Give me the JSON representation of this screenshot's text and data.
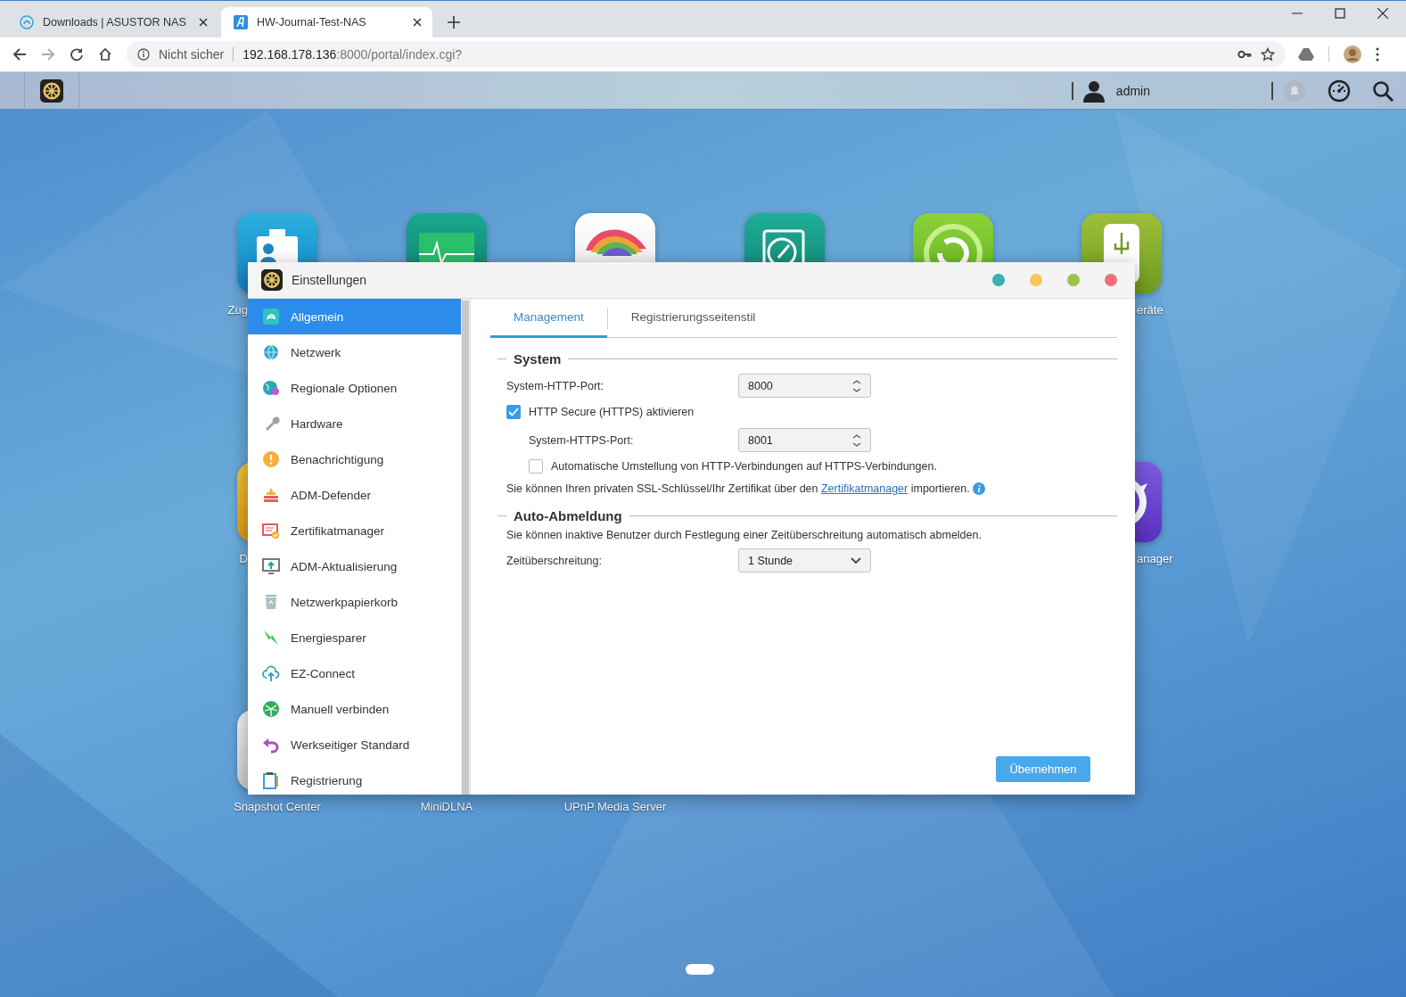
{
  "browser": {
    "tabs": [
      {
        "title": "Downloads | ASUSTOR NAS",
        "selected": false,
        "kind": "asustor"
      },
      {
        "title": "HW-Journal-Test-NAS",
        "selected": true,
        "kind": "adm"
      }
    ],
    "security": "Nicht sicher",
    "url_host": "192.168.178.136",
    "url_path": ":8000/portal/index.cgi?"
  },
  "taskbar": {
    "user": "admin"
  },
  "desktop_icons": [
    {
      "kind": "contacts",
      "label": "Zug"
    },
    {
      "kind": "monitor"
    },
    {
      "kind": "rainbow"
    },
    {
      "kind": "compass"
    },
    {
      "kind": "backup"
    },
    {
      "kind": "usb",
      "label": "eräte"
    },
    {
      "kind": "yellow",
      "label": "D"
    },
    {
      "kind": "purple",
      "label": "anager"
    },
    {
      "kind": "gray",
      "label": "Snapshot Center"
    },
    {
      "kind": "hidden",
      "label": "MiniDLNA"
    },
    {
      "kind": "hidden",
      "label": "UPnP Media Server"
    }
  ],
  "window": {
    "title": "Einstellungen"
  },
  "sidebar": {
    "items": [
      {
        "label": "Allgemein",
        "kind": "general",
        "selected": true
      },
      {
        "label": "Netzwerk",
        "kind": "network",
        "selected": false
      },
      {
        "label": "Regionale Optionen",
        "kind": "regional",
        "selected": false
      },
      {
        "label": "Hardware",
        "kind": "hardware",
        "selected": false
      },
      {
        "label": "Benachrichtigung",
        "kind": "notification",
        "selected": false
      },
      {
        "label": "ADM-Defender",
        "kind": "defender",
        "selected": false
      },
      {
        "label": "Zertifikatmanager",
        "kind": "certificate",
        "selected": false
      },
      {
        "label": "ADM-Aktualisierung",
        "kind": "update",
        "selected": false
      },
      {
        "label": "Netzwerkpapierkorb",
        "kind": "recycle",
        "selected": false
      },
      {
        "label": "Energiesparer",
        "kind": "energy",
        "selected": false
      },
      {
        "label": "EZ-Connect",
        "kind": "ezconnect",
        "selected": false
      },
      {
        "label": "Manuell verbinden",
        "kind": "manual",
        "selected": false
      },
      {
        "label": "Werkseitiger Standard",
        "kind": "factory",
        "selected": false
      },
      {
        "label": "Registrierung",
        "kind": "registration",
        "selected": false
      }
    ]
  },
  "tabs": [
    {
      "label": "Management",
      "selected": true
    },
    {
      "label": "Registrierungsseitenstil",
      "selected": false
    }
  ],
  "system": {
    "title": "System",
    "http_port": {
      "label": "System-HTTP-Port:",
      "value": "8000"
    },
    "https": {
      "label": "HTTP Secure (HTTPS) aktivieren",
      "checked": true
    },
    "https_port": {
      "label": "System-HTTPS-Port:",
      "value": "8001"
    },
    "redirect": {
      "label": "Automatische Umstellung von HTTP-Verbindungen auf HTTPS-Verbindungen.",
      "checked": false
    },
    "note": {
      "before": "Sie können Ihren privaten SSL-Schlüssel/Ihr Zertifikat über den ",
      "link": "Zertifikatmanager",
      "after": " importieren."
    }
  },
  "auto_logout": {
    "title": "Auto-Abmeldung",
    "description": "Sie können inaktive Benutzer durch Festlegung einer Zeitüberschreitung automatisch abmelden.",
    "timeout": {
      "label": "Zeitüberschreitung:",
      "value": "1 Stunde"
    }
  },
  "apply_button": "Übernehmen"
}
